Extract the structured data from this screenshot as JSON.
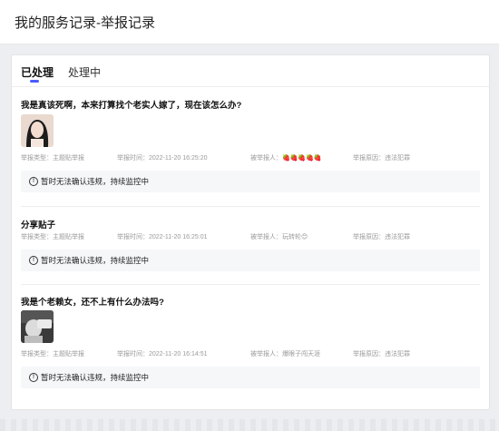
{
  "header": {
    "title": "我的服务记录-举报记录"
  },
  "tabs": [
    {
      "label": "已处理",
      "active": true
    },
    {
      "label": "处理中",
      "active": false
    }
  ],
  "records": [
    {
      "title": "我是真该死啊，本来打算找个老实人嫁了，现在该怎么办?",
      "has_thumb": true,
      "type": "举报类型：主题贴举报",
      "time": "举报时间：2022-11-20 16:25:20",
      "reported": "被举报人：🍓🍓🍓🍓🍓",
      "reason": "举报原因：违法犯罪",
      "status": "暂时无法确认违规，持续监控中"
    },
    {
      "title": "分享贴子",
      "has_thumb": false,
      "type": "举报类型：主题贴举报",
      "time": "举报时间：2022-11-20 16:25:01",
      "reported": "被举报人：玩转轮😊",
      "reason": "举报原因：违法犯罪",
      "status": "暂时无法确认违规，持续监控中"
    },
    {
      "title": "我是个老赖女，还不上有什么办法吗?",
      "has_thumb": true,
      "type": "举报类型：主题贴举报",
      "time": "举报时间：2022-11-20 16:14:51",
      "reported": "被举报人：爆眼子闯天涯",
      "reason": "举报原因：违法犯罪",
      "status": "暂时无法确认违规，持续监控中"
    }
  ],
  "colors": {
    "accent": "#4b5cff",
    "status_bg": "#f6f7f9",
    "meta_text": "#9a9a9a"
  }
}
